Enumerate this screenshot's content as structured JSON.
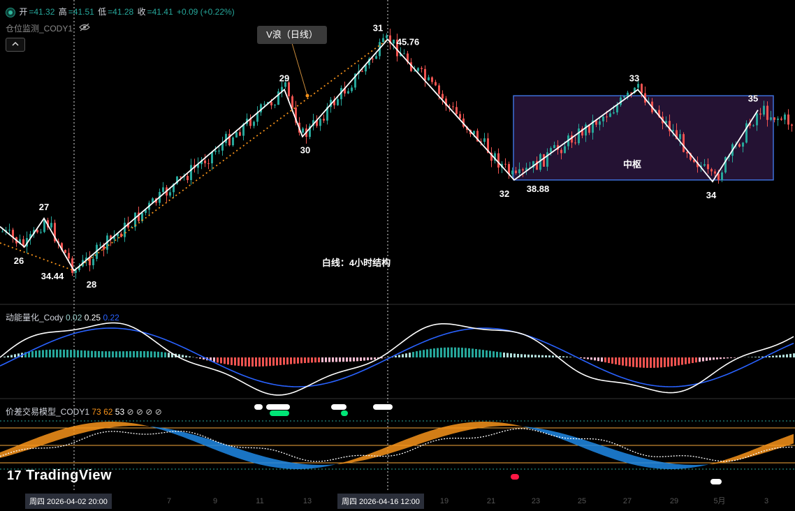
{
  "header": {
    "ohlc": {
      "open_label": "开",
      "open": "=41.32",
      "high_label": "高",
      "high": "=41.51",
      "low_label": "低",
      "low": "=41.28",
      "close_label": "收",
      "close": "=41.41",
      "change": "+0.09 (+0.22%)"
    },
    "indicator1_title": "仓位监测_CODY1",
    "momentum_title": "动能量化_Cody",
    "momentum_values": [
      "0.02",
      "0.25",
      "0.22"
    ],
    "spread_title": "价差交易模型_CODY1",
    "spread_values": [
      "73",
      "62",
      "53",
      "⊘",
      "⊘",
      "⊘",
      "⊘"
    ]
  },
  "callout": "V浪（日线）",
  "annotations": {
    "white_line_note": "白线：4小时结构",
    "zhongshu": "中枢"
  },
  "time_labels": [
    "周四 2026-04-02   20:00",
    "周四 2026-04-16   12:00"
  ],
  "watermark": "TradingView",
  "colors": {
    "up": "#26a69a",
    "down": "#ef5350",
    "white": "#ffffff",
    "orange": "#f7931a",
    "blue": "#2962ff",
    "box_border": "#3d6fd9",
    "box_fill": "#241233"
  },
  "chart_data": [
    {
      "type": "line",
      "name": "price-structure",
      "pivots": [
        {
          "label": "26",
          "value": 35.6
        },
        {
          "label": "27",
          "value": 37.0
        },
        {
          "label": "28",
          "value": 34.44,
          "price_note": "34.44"
        },
        {
          "label": "29",
          "value": 43.3
        },
        {
          "label": "30",
          "value": 41.0
        },
        {
          "label": "31",
          "value": 45.76,
          "price_note": "45.76"
        },
        {
          "label": "32",
          "value": 38.88,
          "price_note": "38.88"
        },
        {
          "label": "33",
          "value": 43.3
        },
        {
          "label": "34",
          "value": 38.8
        },
        {
          "label": "35",
          "value": 42.3
        }
      ],
      "x_ticks": [
        "7",
        "9",
        "11",
        "13",
        "19",
        "21",
        "23",
        "25",
        "27",
        "29",
        "5月",
        "3"
      ],
      "ylim": [
        33.0,
        47.0
      ]
    },
    {
      "type": "bar",
      "name": "momentum",
      "values": [
        0.02,
        0.25,
        0.22
      ]
    },
    {
      "type": "area",
      "name": "spread",
      "values": [
        73,
        62,
        53
      ]
    }
  ]
}
